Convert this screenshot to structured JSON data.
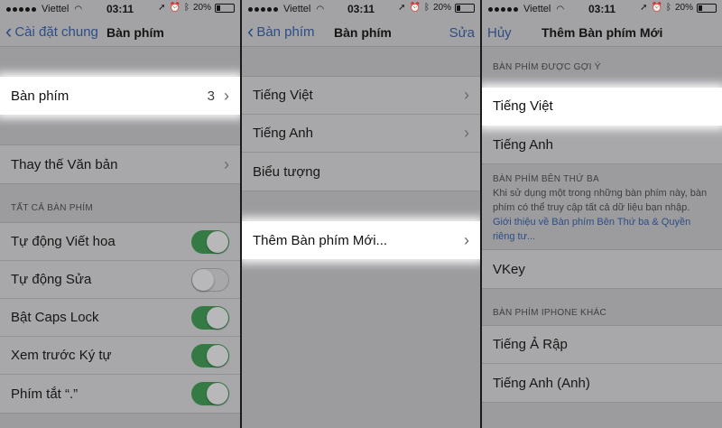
{
  "status": {
    "carrier": "Viettel",
    "time": "03:11",
    "battery": "20%"
  },
  "colors": {
    "accent": "#2d4d86",
    "toggle_on": "#357a45"
  },
  "panel1": {
    "back_label": "Cài đặt chung",
    "title": "Bàn phím",
    "keyboards_row": {
      "label": "Bàn phím",
      "value": "3"
    },
    "text_replacement": "Thay thế Văn bản",
    "section_header": "TẤT CẢ BÀN PHÍM",
    "toggles": [
      {
        "label": "Tự động Viết hoa",
        "on": true
      },
      {
        "label": "Tự động Sửa",
        "on": false
      },
      {
        "label": "Bật Caps Lock",
        "on": true
      },
      {
        "label": "Xem trước Ký tự",
        "on": true
      },
      {
        "label": "Phím tắt “.”",
        "on": true
      }
    ]
  },
  "panel2": {
    "back_label": "Bàn phím",
    "title": "Bàn phím",
    "action": "Sửa",
    "keyboards": [
      "Tiếng Việt",
      "Tiếng Anh",
      "Biểu tượng"
    ],
    "add_new": "Thêm Bàn phím Mới..."
  },
  "panel3": {
    "cancel": "Hủy",
    "title": "Thêm Bàn phím Mới",
    "suggested_header": "BÀN PHÍM ĐƯỢC GỢI Ý",
    "suggested": [
      "Tiếng Việt",
      "Tiếng Anh"
    ],
    "third_party_header": "BÀN PHÍM BÊN THỨ BA",
    "third_party_desc": "Khi sử dụng một trong những bàn phím này, bàn phím có thể truy cập tất cả dữ liệu bạn nhập.",
    "third_party_link": "Giới thiệu về Bàn phím Bên Thứ ba & Quyền riêng tư...",
    "third_party": [
      "VKey"
    ],
    "other_header": "BÀN PHÍM IPHONE KHÁC",
    "other": [
      "Tiếng Ả Rập",
      "Tiếng Anh (Anh)"
    ]
  }
}
